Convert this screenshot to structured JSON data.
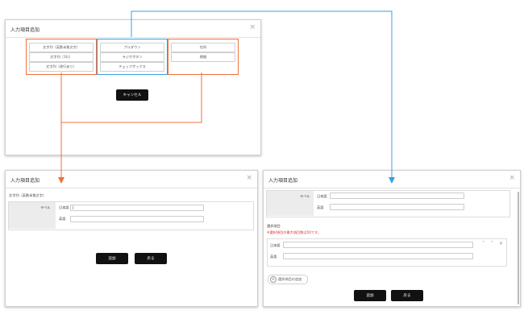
{
  "dialog_top": {
    "title": "入力項目追加",
    "close": "×",
    "text_buttons": [
      "文字列（英数半角文字）",
      "文字列（1行）",
      "文字列（改行あり）"
    ],
    "choice_buttons": [
      "プルダウン",
      "ラジオボタン",
      "チェックボックス"
    ],
    "other_buttons": [
      "住所",
      "期間"
    ],
    "cancel_label": "キャンセル"
  },
  "dialog_left": {
    "title": "入力項目追加",
    "close": "×",
    "section_label": "文字列（英数半角文字）",
    "label_header": "ラベル",
    "ja_label": "日本語",
    "ja_value": "|",
    "en_label": "英語",
    "en_value": "",
    "add_label": "追加",
    "back_label": "戻る"
  },
  "dialog_right": {
    "title": "入力項目追加",
    "close": "×",
    "label_header": "ラベル",
    "ja_label": "日本語",
    "en_label": "英語",
    "options_heading": "選択項目",
    "options_note": "※選択項目の最大項目数は50です。",
    "option_ja_label": "日本語",
    "option_en_label": "英語",
    "up_icon": "˄",
    "down_icon": "˅",
    "remove_icon": "×",
    "add_option_label": "選択項目の追加",
    "add_label": "追加",
    "back_label": "戻る"
  },
  "colors": {
    "orange": "#f0703a",
    "blue": "#3a9fe0"
  }
}
